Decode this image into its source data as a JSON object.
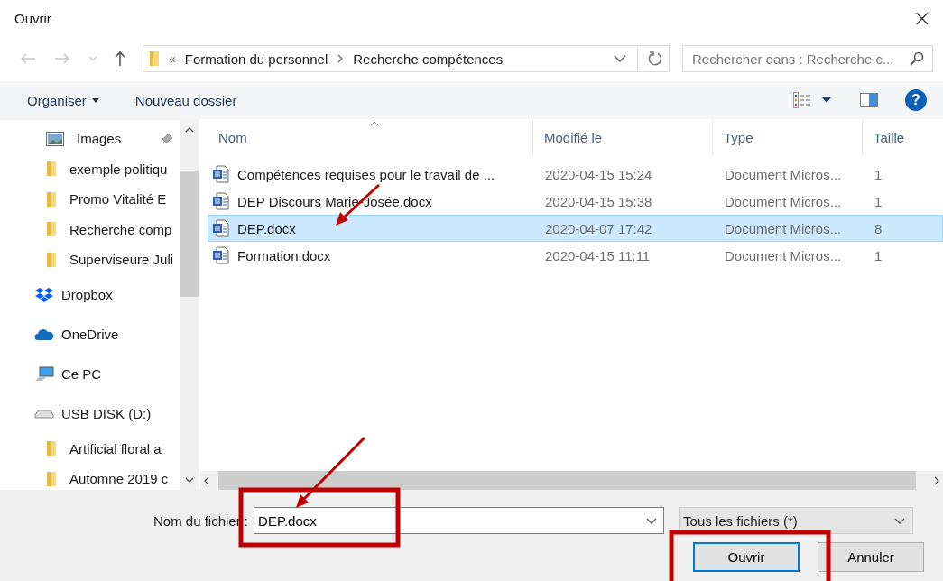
{
  "window": {
    "title": "Ouvrir",
    "close": "×"
  },
  "nav": {
    "breadcrumb_prefix": "«",
    "path": [
      {
        "label": "Formation du personnel"
      },
      {
        "label": "Recherche compétences"
      }
    ],
    "search": {
      "placeholder": "Rechercher dans : Recherche c..."
    }
  },
  "toolbar": {
    "organize": "Organiser",
    "new_folder": "Nouveau dossier",
    "help": "?"
  },
  "sidebar": {
    "items": [
      {
        "label": "Images",
        "kind": "images",
        "pinned": true
      },
      {
        "label": "exemple politiqu",
        "kind": "folder",
        "pinned": false
      },
      {
        "label": "Promo Vitalité E",
        "kind": "folder",
        "pinned": false
      },
      {
        "label": "Recherche comp",
        "kind": "folder",
        "pinned": false
      },
      {
        "label": "Superviseure Juli",
        "kind": "folder",
        "pinned": false
      },
      {
        "label": "Dropbox",
        "kind": "dropbox",
        "pinned": false
      },
      {
        "label": "OneDrive",
        "kind": "onedrive",
        "pinned": false
      },
      {
        "label": "Ce PC",
        "kind": "pc",
        "pinned": false
      },
      {
        "label": "USB DISK (D:)",
        "kind": "drive",
        "pinned": false
      },
      {
        "label": "Artificial floral a",
        "kind": "folder",
        "pinned": false
      },
      {
        "label": "Automne 2019 c",
        "kind": "folder",
        "pinned": false
      }
    ]
  },
  "table": {
    "columns": [
      "Nom",
      "Modifié le",
      "Type",
      "Taille"
    ],
    "rows": [
      {
        "name": "Compétences requises pour le travail de ...",
        "modified": "2020-04-15 15:24",
        "type": "Document Micros...",
        "size": "1",
        "selected": false
      },
      {
        "name": "DEP Discours Marie-Josée.docx",
        "modified": "2020-04-15 15:38",
        "type": "Document Micros...",
        "size": "1",
        "selected": false
      },
      {
        "name": "DEP.docx",
        "modified": "2020-04-07 17:42",
        "type": "Document Micros...",
        "size": "8",
        "selected": true
      },
      {
        "name": "Formation.docx",
        "modified": "2020-04-15 11:11",
        "type": "Document Micros...",
        "size": "1",
        "selected": false
      }
    ]
  },
  "footer": {
    "filename_label": "Nom du fichier :",
    "filename": "DEP.docx",
    "filter": "Tous les fichiers (*)",
    "buttons": [
      {
        "label": "Ouvrir",
        "kind": "primary"
      },
      {
        "label": "Annuler",
        "kind": "secondary"
      }
    ]
  }
}
